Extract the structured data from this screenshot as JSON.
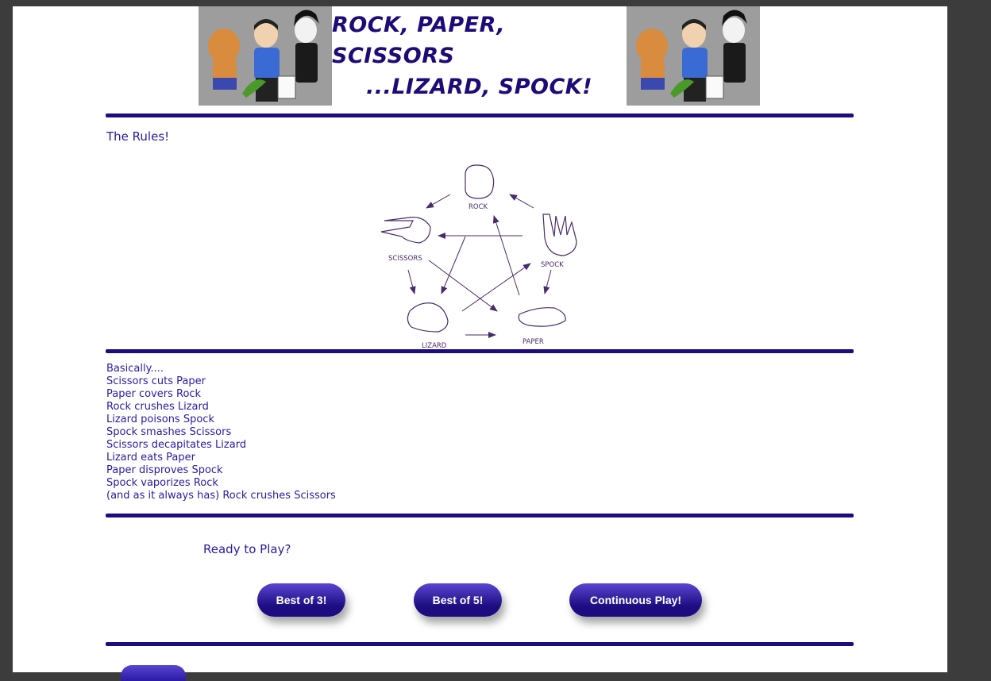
{
  "banner": {
    "title_line1": "ROCK, PAPER, SCISSORS",
    "title_line2": "...LIZARD, SPOCK!",
    "left_art_icon": "characters-illustration",
    "right_art_icon": "characters-illustration"
  },
  "rules_title": "The Rules!",
  "diagram": {
    "labels": {
      "rock": "ROCK",
      "spock": "SPOCK",
      "paper": "PAPER",
      "lizard": "LIZARD",
      "scissors": "SCISSORS"
    }
  },
  "rules_list": [
    "Basically....",
    "Scissors cuts Paper",
    "Paper covers Rock",
    "Rock crushes Lizard",
    "Lizard poisons Spock",
    "Spock smashes Scissors",
    "Scissors decapitates Lizard",
    "Lizard eats Paper",
    "Paper disproves Spock",
    "Spock vaporizes Rock",
    "(and as it always has) Rock crushes Scissors"
  ],
  "ready_text": "Ready to Play?",
  "buttons": {
    "best_of_3": "Best of 3!",
    "best_of_5": "Best of 5!",
    "continuous": "Continuous Play!"
  },
  "colors": {
    "accent": "#1c0c80",
    "text": "#2a1aa6"
  }
}
